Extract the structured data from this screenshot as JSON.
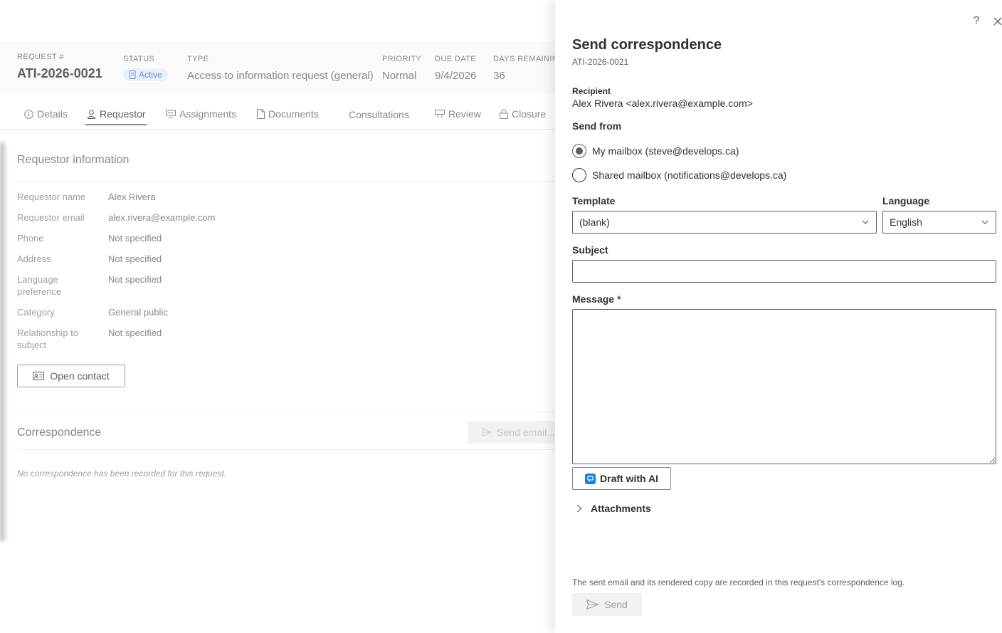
{
  "request_header": {
    "request_label": "REQUEST #",
    "request_id": "ATI-2026-0021",
    "status_label": "STATUS",
    "status_value": "Active",
    "type_label": "TYPE",
    "type_value": "Access to information request (general)",
    "priority_label": "PRIORITY",
    "priority_value": "Normal",
    "due_label": "DUE DATE",
    "due_value": "9/4/2026",
    "days_label": "DAYS REMAINING",
    "days_value": "36"
  },
  "tabs": [
    {
      "label": "Details",
      "icon": "info-icon"
    },
    {
      "label": "Requestor",
      "icon": "person-icon",
      "active": true
    },
    {
      "label": "Assignments",
      "icon": "assignments-icon"
    },
    {
      "label": "Documents",
      "icon": "document-icon"
    },
    {
      "label": "Consultations",
      "icon": ""
    },
    {
      "label": "Review",
      "icon": "review-icon"
    },
    {
      "label": "Closure",
      "icon": "lock-icon"
    }
  ],
  "requestor": {
    "section_title": "Requestor information",
    "fields": [
      {
        "label": "Requestor name",
        "value": "Alex Rivera"
      },
      {
        "label": "Requestor email",
        "value": "alex.rivera@example.com"
      },
      {
        "label": "Phone",
        "value": "Not specified"
      },
      {
        "label": "Address",
        "value": "Not specified"
      },
      {
        "label": "Language preference",
        "value": "Not specified"
      },
      {
        "label": "Category",
        "value": "General public"
      },
      {
        "label": "Relationship to subject",
        "value": "Not specified"
      }
    ],
    "open_contact_label": "Open contact"
  },
  "correspondence": {
    "section_title": "Correspondence",
    "send_email_label": "Send email...",
    "empty_text": "No correspondence has been recorded for this request."
  },
  "panel": {
    "title": "Send correspondence",
    "subtitle": "ATI-2026-0021",
    "help_icon": "?",
    "recipient_label": "Recipient",
    "recipient_value": "Alex Rivera <alex.rivera@example.com>",
    "send_from_label": "Send from",
    "send_from_options": [
      {
        "label": "My mailbox (steve@develops.ca)",
        "selected": true
      },
      {
        "label": "Shared mailbox (notifications@develops.ca)",
        "selected": false
      }
    ],
    "template_label": "Template",
    "template_value": "(blank)",
    "language_label": "Language",
    "language_value": "English",
    "subject_label": "Subject",
    "subject_value": "",
    "message_label": "Message",
    "required_marker": "*",
    "message_value": "",
    "draft_ai_label": "Draft with AI",
    "attachments_label": "Attachments",
    "footer_note": "The sent email and its rendered copy are recorded in this request's correspondence log.",
    "send_label": "Send"
  }
}
